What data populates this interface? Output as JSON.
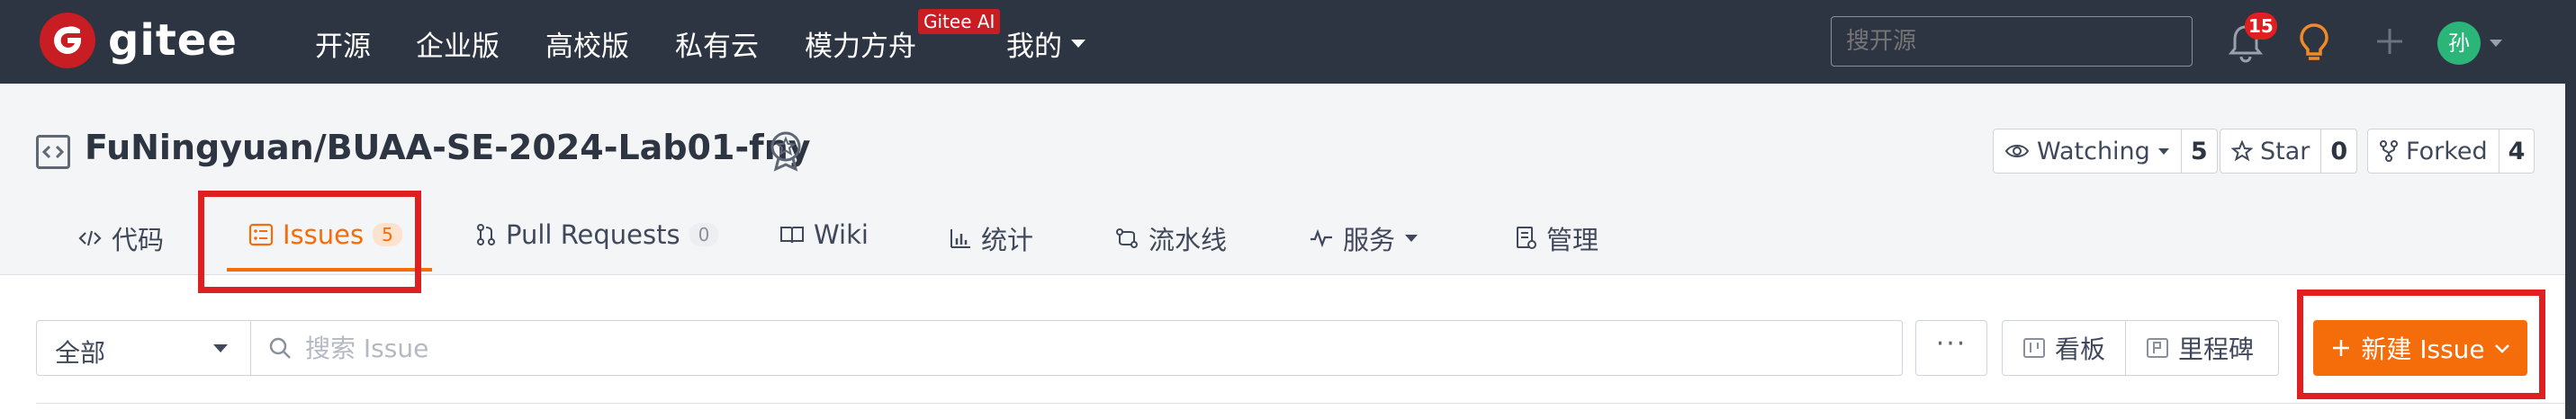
{
  "navbar": {
    "logo_text": "gitee",
    "items": [
      "开源",
      "企业版",
      "高校版",
      "私有云",
      "模力方舟",
      "我的"
    ],
    "ai_badge": "Gitee AI",
    "search_placeholder": "搜开源",
    "notifications_count": "15",
    "avatar_initial": "孙"
  },
  "repo": {
    "title": "FuNingyuan/BUAA-SE-2024-Lab01-fny",
    "watch": {
      "label": "Watching",
      "count": "5"
    },
    "star": {
      "label": "Star",
      "count": "0"
    },
    "fork": {
      "label": "Forked",
      "count": "4"
    }
  },
  "tabs": [
    {
      "label": "代码"
    },
    {
      "label": "Issues",
      "count": "5",
      "active": true
    },
    {
      "label": "Pull Requests",
      "count": "0"
    },
    {
      "label": "Wiki"
    },
    {
      "label": "统计"
    },
    {
      "label": "流水线"
    },
    {
      "label": "服务"
    },
    {
      "label": "管理"
    }
  ],
  "issues_toolbar": {
    "filter_value": "全部",
    "search_placeholder": "搜索 Issue",
    "more_label": "···",
    "board_label": "看板",
    "milestone_label": "里程碑",
    "new_issue_label": "新建 Issue"
  },
  "colors": {
    "navbar_bg": "#2e3542",
    "brand_red": "#c71d23",
    "accent_orange": "#f56c0a",
    "highlight_red": "#e02020"
  }
}
